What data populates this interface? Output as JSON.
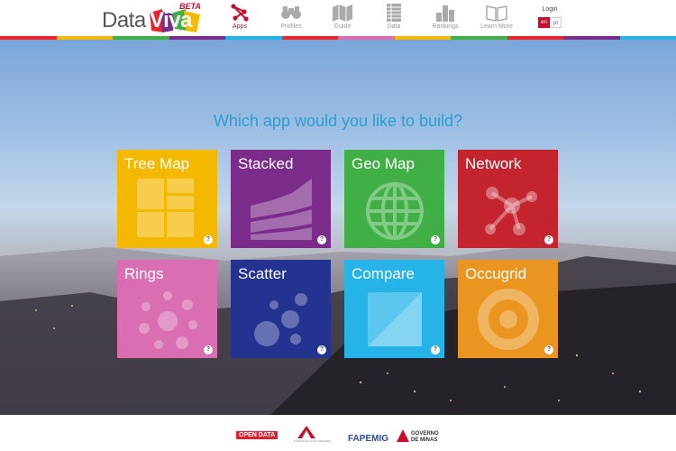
{
  "brand": {
    "data": "Data",
    "viva": "Viva",
    "beta": "BETA"
  },
  "nav": [
    {
      "label": "Apps",
      "icon": "apps-icon"
    },
    {
      "label": "Profiles",
      "icon": "binoculars-icon"
    },
    {
      "label": "Guide",
      "icon": "map-icon"
    },
    {
      "label": "Data",
      "icon": "table-icon"
    },
    {
      "label": "Rankings",
      "icon": "bar-chart-icon"
    },
    {
      "label": "Learn More",
      "icon": "book-icon"
    }
  ],
  "login": {
    "label": "Login",
    "lang_en": "en",
    "lang_pt": "pt"
  },
  "main": {
    "question": "Which app would you like to build?",
    "apps": [
      {
        "name": "Tree Map",
        "color": "#f5b800",
        "help": "?"
      },
      {
        "name": "Stacked",
        "color": "#7b2c8a",
        "help": "?"
      },
      {
        "name": "Geo Map",
        "color": "#3faf46",
        "help": "?"
      },
      {
        "name": "Network",
        "color": "#c3242d",
        "help": "?"
      },
      {
        "name": "Rings",
        "color": "#d96fb2",
        "help": "?"
      },
      {
        "name": "Scatter",
        "color": "#23338f",
        "help": "?"
      },
      {
        "name": "Compare",
        "color": "#25b3e8",
        "help": "?"
      },
      {
        "name": "Occugrid",
        "color": "#e9951f",
        "help": "?"
      }
    ]
  },
  "footer": {
    "sponsors": [
      "OPEN DATA",
      "FUNDAÇÃO JOÃO PINHEIRO",
      "FAPEMIG",
      "GOVERNO DE MINAS"
    ]
  }
}
